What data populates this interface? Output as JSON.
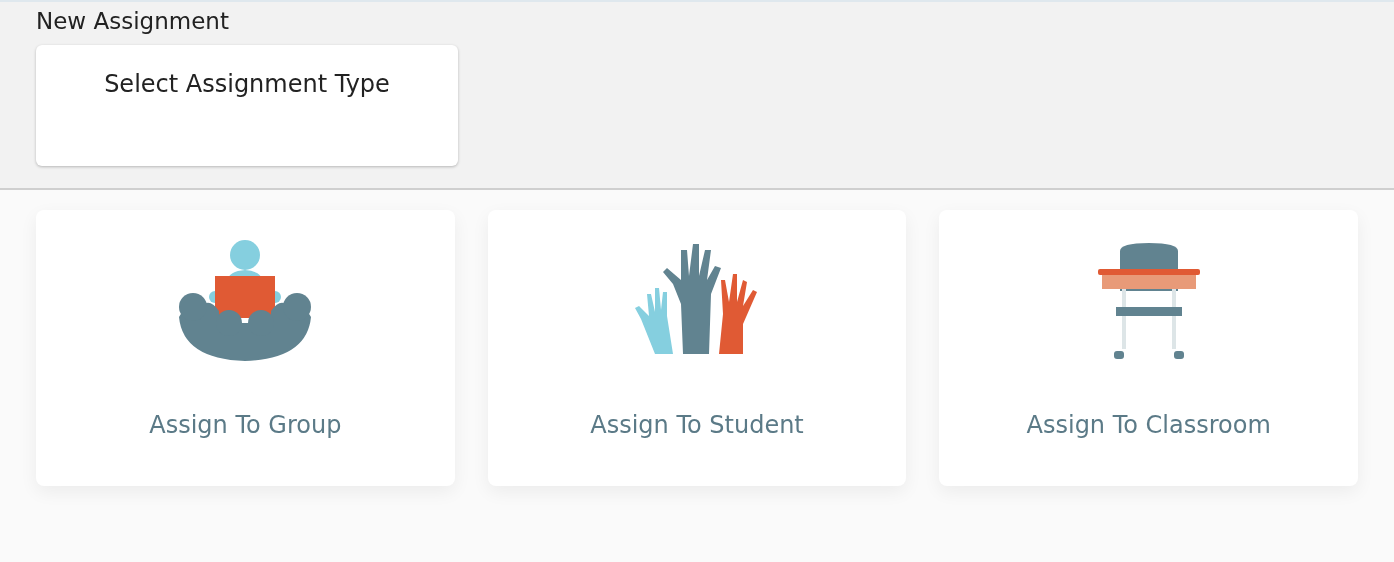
{
  "header": {
    "title": "New Assignment",
    "select_card": {
      "label": "Select Assignment Type"
    }
  },
  "options": [
    {
      "kind": "group",
      "label": "Assign To Group"
    },
    {
      "kind": "student",
      "label": "Assign To Student"
    },
    {
      "kind": "classroom",
      "label": "Assign To Classroom"
    }
  ]
}
